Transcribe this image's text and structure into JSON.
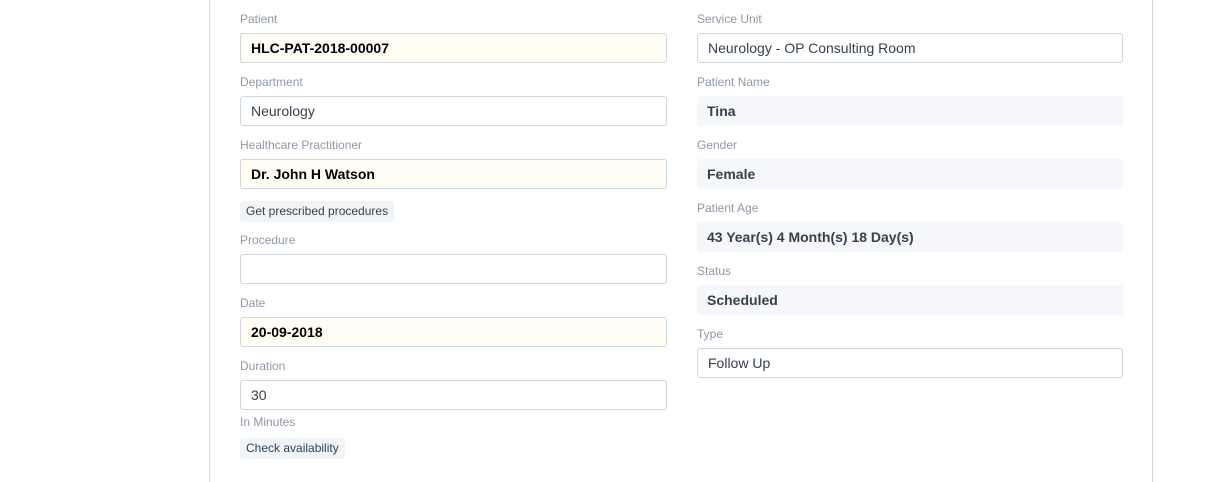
{
  "left": {
    "patient_label": "Patient",
    "patient_value": "HLC-PAT-2018-00007",
    "department_label": "Department",
    "department_value": "Neurology",
    "practitioner_label": "Healthcare Practitioner",
    "practitioner_value": "Dr. John H Watson",
    "get_procedures_button": "Get prescribed procedures",
    "procedure_label": "Procedure",
    "procedure_value": "",
    "date_label": "Date",
    "date_value": "20-09-2018",
    "duration_label": "Duration",
    "duration_value": "30",
    "duration_help": "In Minutes",
    "check_availability_button": "Check availability"
  },
  "right": {
    "service_unit_label": "Service Unit",
    "service_unit_value": "Neurology - OP Consulting Room",
    "patient_name_label": "Patient Name",
    "patient_name_value": "Tina",
    "gender_label": "Gender",
    "gender_value": "Female",
    "patient_age_label": "Patient Age",
    "patient_age_value": "43 Year(s) 4 Month(s) 18 Day(s)",
    "status_label": "Status",
    "status_value": "Scheduled",
    "type_label": "Type",
    "type_value": "Follow Up"
  }
}
